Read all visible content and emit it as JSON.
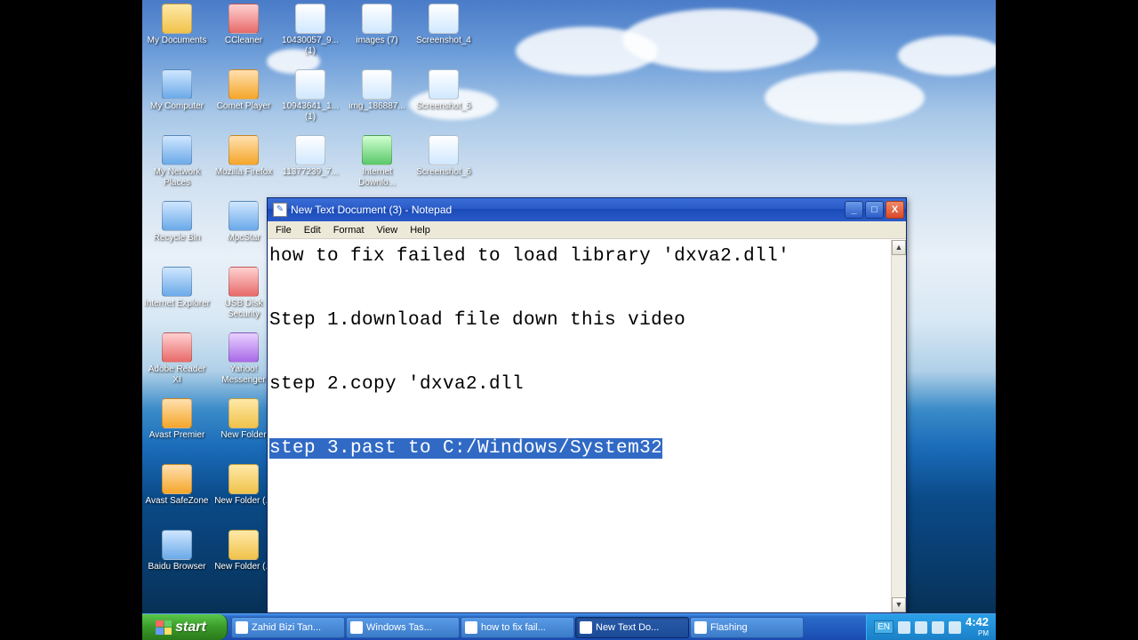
{
  "desktop_icons": [
    {
      "label": "My Documents",
      "cls": "ic-folder",
      "col": 0,
      "row": 0
    },
    {
      "label": "CCleaner",
      "cls": "ic-red",
      "col": 1,
      "row": 0
    },
    {
      "label": "10430057_9... (1)",
      "cls": "ic-img",
      "col": 2,
      "row": 0
    },
    {
      "label": "images (7)",
      "cls": "ic-img",
      "col": 3,
      "row": 0
    },
    {
      "label": "Screenshot_4",
      "cls": "ic-img",
      "col": 4,
      "row": 0
    },
    {
      "label": "My Computer",
      "cls": "ic-blue",
      "col": 0,
      "row": 1
    },
    {
      "label": "Comet Player",
      "cls": "ic-orange",
      "col": 1,
      "row": 1
    },
    {
      "label": "10943641_1... (1)",
      "cls": "ic-img",
      "col": 2,
      "row": 1
    },
    {
      "label": "img_186887...",
      "cls": "ic-img",
      "col": 3,
      "row": 1
    },
    {
      "label": "Screenshot_5",
      "cls": "ic-img",
      "col": 4,
      "row": 1
    },
    {
      "label": "My Network Places",
      "cls": "ic-blue",
      "col": 0,
      "row": 2
    },
    {
      "label": "Mozilla Firefox",
      "cls": "ic-orange",
      "col": 1,
      "row": 2
    },
    {
      "label": "11377239_7...",
      "cls": "ic-img",
      "col": 2,
      "row": 2
    },
    {
      "label": "Internet Downlo...",
      "cls": "ic-green",
      "col": 3,
      "row": 2
    },
    {
      "label": "Screenshot_6",
      "cls": "ic-img",
      "col": 4,
      "row": 2
    },
    {
      "label": "Recycle Bin",
      "cls": "ic-blue",
      "col": 0,
      "row": 3
    },
    {
      "label": "MpcStar",
      "cls": "ic-blue",
      "col": 1,
      "row": 3
    },
    {
      "label": "Internet Explorer",
      "cls": "ic-blue",
      "col": 0,
      "row": 4
    },
    {
      "label": "USB Disk Security",
      "cls": "ic-red",
      "col": 1,
      "row": 4
    },
    {
      "label": "Adobe Reader XI",
      "cls": "ic-red",
      "col": 0,
      "row": 5
    },
    {
      "label": "Yahoo! Messenger",
      "cls": "ic-purple",
      "col": 1,
      "row": 5
    },
    {
      "label": "Avast Premier",
      "cls": "ic-orange",
      "col": 0,
      "row": 6
    },
    {
      "label": "New Folder",
      "cls": "ic-folder",
      "col": 1,
      "row": 6
    },
    {
      "label": "Avast SafeZone",
      "cls": "ic-orange",
      "col": 0,
      "row": 7
    },
    {
      "label": "New Folder (...",
      "cls": "ic-folder",
      "col": 1,
      "row": 7
    },
    {
      "label": "Baidu Browser",
      "cls": "ic-blue",
      "col": 0,
      "row": 8
    },
    {
      "label": "New Folder (...",
      "cls": "ic-folder",
      "col": 1,
      "row": 8
    }
  ],
  "notepad": {
    "title": "New Text Document (3) - Notepad",
    "menus": [
      "File",
      "Edit",
      "Format",
      "View",
      "Help"
    ],
    "line1": "how to fix failed to load library 'dxva2.dll'",
    "line2": "",
    "line3": "Step 1.download file down this video",
    "line4": "",
    "line5": "step 2.copy 'dxva2.dll",
    "line6": "",
    "selected": "step 3.past to C:/Windows/System32",
    "win_min": "_",
    "win_max": "□",
    "win_close": "X",
    "scroll_up": "▲",
    "scroll_down": "▼"
  },
  "taskbar": {
    "start": "start",
    "items": [
      {
        "label": "Zahid Bizi Tan...",
        "active": false
      },
      {
        "label": "Windows Tas...",
        "active": false
      },
      {
        "label": "how to fix fail...",
        "active": false
      },
      {
        "label": "New Text Do...",
        "active": true
      },
      {
        "label": "Flashing",
        "active": false
      }
    ],
    "lang": "EN",
    "clock_time": "4:42",
    "clock_ampm": "PM"
  }
}
